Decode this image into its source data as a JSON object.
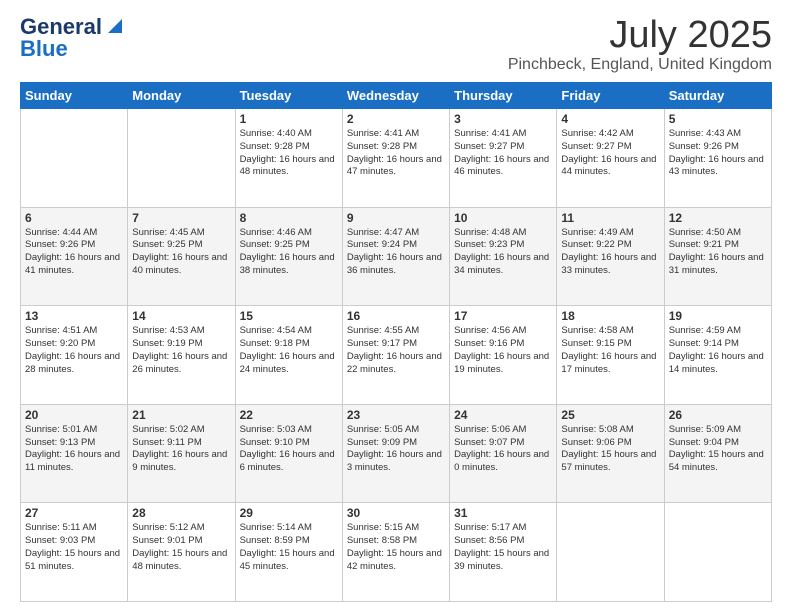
{
  "header": {
    "logo_general": "General",
    "logo_blue": "Blue",
    "month_year": "July 2025",
    "location": "Pinchbeck, England, United Kingdom"
  },
  "days_of_week": [
    "Sunday",
    "Monday",
    "Tuesday",
    "Wednesday",
    "Thursday",
    "Friday",
    "Saturday"
  ],
  "weeks": [
    [
      {
        "day": "",
        "info": ""
      },
      {
        "day": "",
        "info": ""
      },
      {
        "day": "1",
        "info": "Sunrise: 4:40 AM\nSunset: 9:28 PM\nDaylight: 16 hours and 48 minutes."
      },
      {
        "day": "2",
        "info": "Sunrise: 4:41 AM\nSunset: 9:28 PM\nDaylight: 16 hours and 47 minutes."
      },
      {
        "day": "3",
        "info": "Sunrise: 4:41 AM\nSunset: 9:27 PM\nDaylight: 16 hours and 46 minutes."
      },
      {
        "day": "4",
        "info": "Sunrise: 4:42 AM\nSunset: 9:27 PM\nDaylight: 16 hours and 44 minutes."
      },
      {
        "day": "5",
        "info": "Sunrise: 4:43 AM\nSunset: 9:26 PM\nDaylight: 16 hours and 43 minutes."
      }
    ],
    [
      {
        "day": "6",
        "info": "Sunrise: 4:44 AM\nSunset: 9:26 PM\nDaylight: 16 hours and 41 minutes."
      },
      {
        "day": "7",
        "info": "Sunrise: 4:45 AM\nSunset: 9:25 PM\nDaylight: 16 hours and 40 minutes."
      },
      {
        "day": "8",
        "info": "Sunrise: 4:46 AM\nSunset: 9:25 PM\nDaylight: 16 hours and 38 minutes."
      },
      {
        "day": "9",
        "info": "Sunrise: 4:47 AM\nSunset: 9:24 PM\nDaylight: 16 hours and 36 minutes."
      },
      {
        "day": "10",
        "info": "Sunrise: 4:48 AM\nSunset: 9:23 PM\nDaylight: 16 hours and 34 minutes."
      },
      {
        "day": "11",
        "info": "Sunrise: 4:49 AM\nSunset: 9:22 PM\nDaylight: 16 hours and 33 minutes."
      },
      {
        "day": "12",
        "info": "Sunrise: 4:50 AM\nSunset: 9:21 PM\nDaylight: 16 hours and 31 minutes."
      }
    ],
    [
      {
        "day": "13",
        "info": "Sunrise: 4:51 AM\nSunset: 9:20 PM\nDaylight: 16 hours and 28 minutes."
      },
      {
        "day": "14",
        "info": "Sunrise: 4:53 AM\nSunset: 9:19 PM\nDaylight: 16 hours and 26 minutes."
      },
      {
        "day": "15",
        "info": "Sunrise: 4:54 AM\nSunset: 9:18 PM\nDaylight: 16 hours and 24 minutes."
      },
      {
        "day": "16",
        "info": "Sunrise: 4:55 AM\nSunset: 9:17 PM\nDaylight: 16 hours and 22 minutes."
      },
      {
        "day": "17",
        "info": "Sunrise: 4:56 AM\nSunset: 9:16 PM\nDaylight: 16 hours and 19 minutes."
      },
      {
        "day": "18",
        "info": "Sunrise: 4:58 AM\nSunset: 9:15 PM\nDaylight: 16 hours and 17 minutes."
      },
      {
        "day": "19",
        "info": "Sunrise: 4:59 AM\nSunset: 9:14 PM\nDaylight: 16 hours and 14 minutes."
      }
    ],
    [
      {
        "day": "20",
        "info": "Sunrise: 5:01 AM\nSunset: 9:13 PM\nDaylight: 16 hours and 11 minutes."
      },
      {
        "day": "21",
        "info": "Sunrise: 5:02 AM\nSunset: 9:11 PM\nDaylight: 16 hours and 9 minutes."
      },
      {
        "day": "22",
        "info": "Sunrise: 5:03 AM\nSunset: 9:10 PM\nDaylight: 16 hours and 6 minutes."
      },
      {
        "day": "23",
        "info": "Sunrise: 5:05 AM\nSunset: 9:09 PM\nDaylight: 16 hours and 3 minutes."
      },
      {
        "day": "24",
        "info": "Sunrise: 5:06 AM\nSunset: 9:07 PM\nDaylight: 16 hours and 0 minutes."
      },
      {
        "day": "25",
        "info": "Sunrise: 5:08 AM\nSunset: 9:06 PM\nDaylight: 15 hours and 57 minutes."
      },
      {
        "day": "26",
        "info": "Sunrise: 5:09 AM\nSunset: 9:04 PM\nDaylight: 15 hours and 54 minutes."
      }
    ],
    [
      {
        "day": "27",
        "info": "Sunrise: 5:11 AM\nSunset: 9:03 PM\nDaylight: 15 hours and 51 minutes."
      },
      {
        "day": "28",
        "info": "Sunrise: 5:12 AM\nSunset: 9:01 PM\nDaylight: 15 hours and 48 minutes."
      },
      {
        "day": "29",
        "info": "Sunrise: 5:14 AM\nSunset: 8:59 PM\nDaylight: 15 hours and 45 minutes."
      },
      {
        "day": "30",
        "info": "Sunrise: 5:15 AM\nSunset: 8:58 PM\nDaylight: 15 hours and 42 minutes."
      },
      {
        "day": "31",
        "info": "Sunrise: 5:17 AM\nSunset: 8:56 PM\nDaylight: 15 hours and 39 minutes."
      },
      {
        "day": "",
        "info": ""
      },
      {
        "day": "",
        "info": ""
      }
    ]
  ]
}
